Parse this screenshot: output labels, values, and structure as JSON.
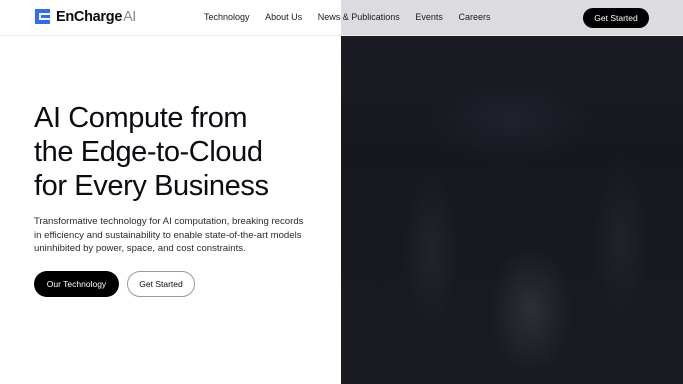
{
  "brand": {
    "name": "EnCharge",
    "suffix": "AI",
    "logo_color": "#2f6bff"
  },
  "nav": {
    "items": [
      {
        "label": "Technology"
      },
      {
        "label": "About Us"
      },
      {
        "label": "News & Publications"
      },
      {
        "label": "Events"
      },
      {
        "label": "Careers"
      }
    ],
    "cta_label": "Get Started"
  },
  "hero": {
    "title_lines": [
      "AI Compute from",
      "the Edge-to-Cloud",
      "for Every Business"
    ],
    "description": "Transformative technology for AI computation, breaking records in efficiency and sustainability to enable state-of-the-art models uninhibited by power, space, and cost constraints.",
    "primary_button": "Our Technology",
    "secondary_button": "Get Started"
  },
  "colors": {
    "background": "#ffffff",
    "hero_media": "#1a1a22",
    "button_dark": "#000000",
    "text": "#0b0b12"
  }
}
